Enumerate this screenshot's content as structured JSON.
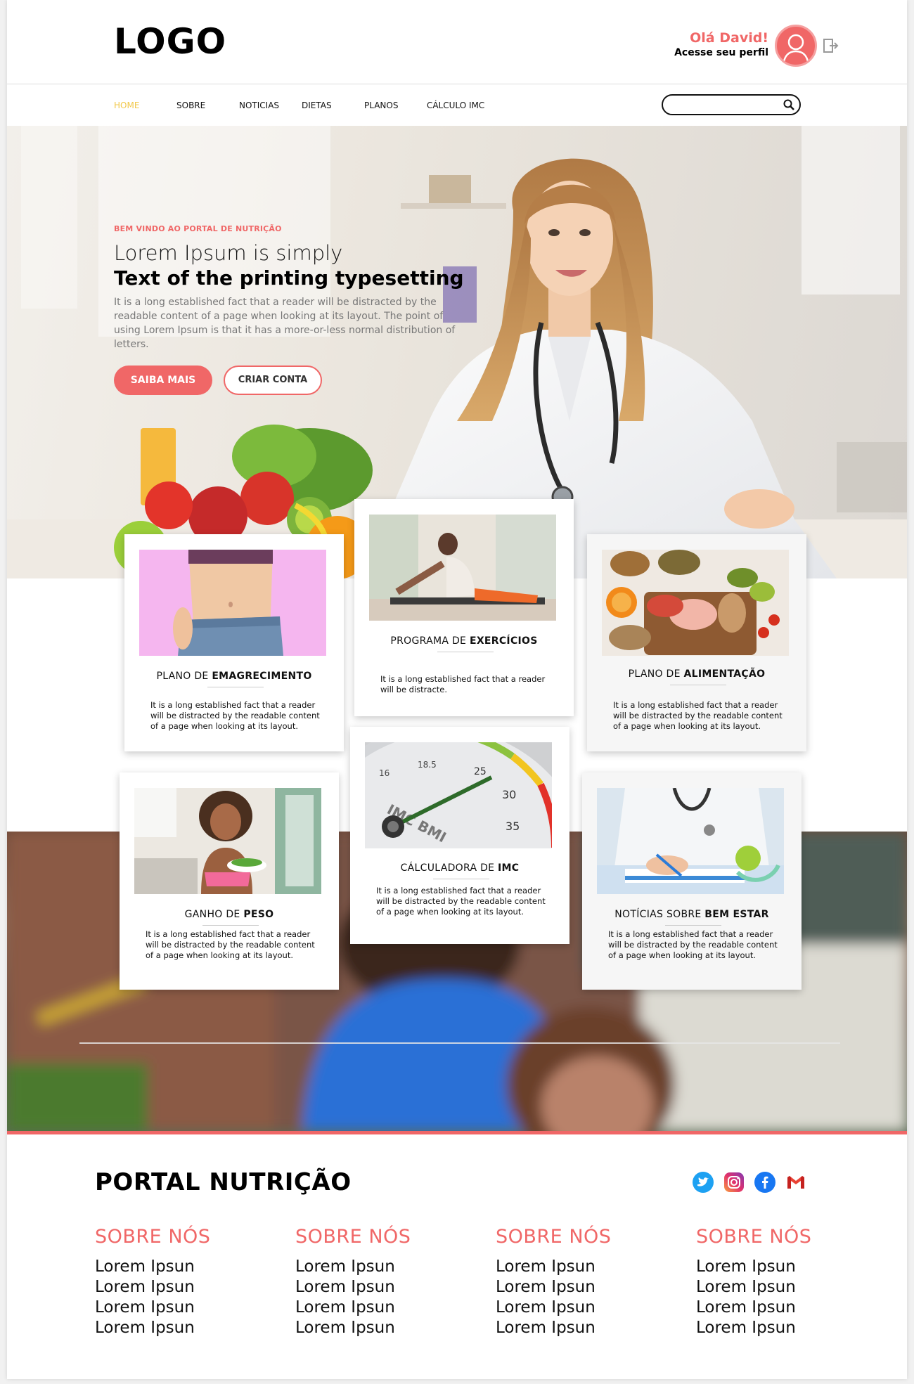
{
  "header": {
    "logo": "LOGO",
    "greeting_title": "Olá David!",
    "greeting_sub": "Acesse seu perfil"
  },
  "nav": {
    "items": [
      "HOME",
      "SOBRE",
      "NOTICIAS",
      "DIETAS",
      "PLANOS",
      "CÁLCULO IMC"
    ],
    "active": "HOME",
    "search_placeholder": ""
  },
  "hero": {
    "eyebrow": "BEM VINDO AO PORTAL DE NUTRIÇÃO",
    "title_line1": "Lorem Ipsum is simply",
    "title_line2": "Text of the printing typesetting",
    "description": "It is a long established fact that a reader will be distracted by the readable content of a page when looking at its layout. The point of using Lorem Ipsum is that it has a more-or-less normal distribution of letters.",
    "primary_button": "SAIBA MAIS",
    "secondary_button": "CRIAR CONTA"
  },
  "cards": [
    {
      "title_prefix": "PLANO DE ",
      "title_bold": "EMAGRECIMENTO",
      "text": "It is a long established fact that a reader will be distracted by the readable content of a page when looking at its layout."
    },
    {
      "title_prefix": "PROGRAMA DE ",
      "title_bold": "EXERCÍCIOS",
      "text": "It is a long established fact that a reader will be distracte."
    },
    {
      "title_prefix": "PLANO DE ",
      "title_bold": "ALIMENTAÇÃO",
      "text": "It is a long established fact that a reader will be distracted by the readable content of a page when looking at its layout."
    },
    {
      "title_prefix": "GANHO DE ",
      "title_bold": "PESO",
      "text": "It is a long established fact that a reader will be distracted by the readable content of a page when looking at its layout."
    },
    {
      "title_prefix": "CÁLCULADORA DE ",
      "title_bold": "IMC",
      "text": "It is a long established fact that a reader will be distracted by the readable content of a page when looking at its layout."
    },
    {
      "title_prefix": "NOTÍCIAS SOBRE ",
      "title_bold": "BEM ESTAR",
      "text": "It is a long established fact that a reader will be distracted by the readable content of a page when looking at its layout."
    }
  ],
  "gauge": {
    "labels": [
      "16",
      "18.5",
      "25",
      "30",
      "35"
    ],
    "dial_text": "IMC BMI"
  },
  "footer": {
    "title": "PORTAL NUTRIÇÃO",
    "social_icons": [
      "twitter-icon",
      "instagram-icon",
      "facebook-icon",
      "gmail-icon"
    ],
    "columns": [
      {
        "heading": "SOBRE NÓS",
        "links": [
          "Lorem Ipsun",
          "Lorem Ipsun",
          "Lorem Ipsun",
          "Lorem Ipsun"
        ]
      },
      {
        "heading": "SOBRE NÓS",
        "links": [
          "Lorem Ipsun",
          "Lorem Ipsun",
          "Lorem Ipsun",
          "Lorem Ipsun"
        ]
      },
      {
        "heading": "SOBRE NÓS",
        "links": [
          "Lorem Ipsun",
          "Lorem Ipsun",
          "Lorem Ipsun",
          "Lorem Ipsun"
        ]
      },
      {
        "heading": "SOBRE NÓS",
        "links": [
          "Lorem Ipsun",
          "Lorem Ipsun",
          "Lorem Ipsun",
          "Lorem Ipsun"
        ]
      }
    ]
  },
  "colors": {
    "accent": "#f06767",
    "active_nav": "#f2c94c"
  }
}
